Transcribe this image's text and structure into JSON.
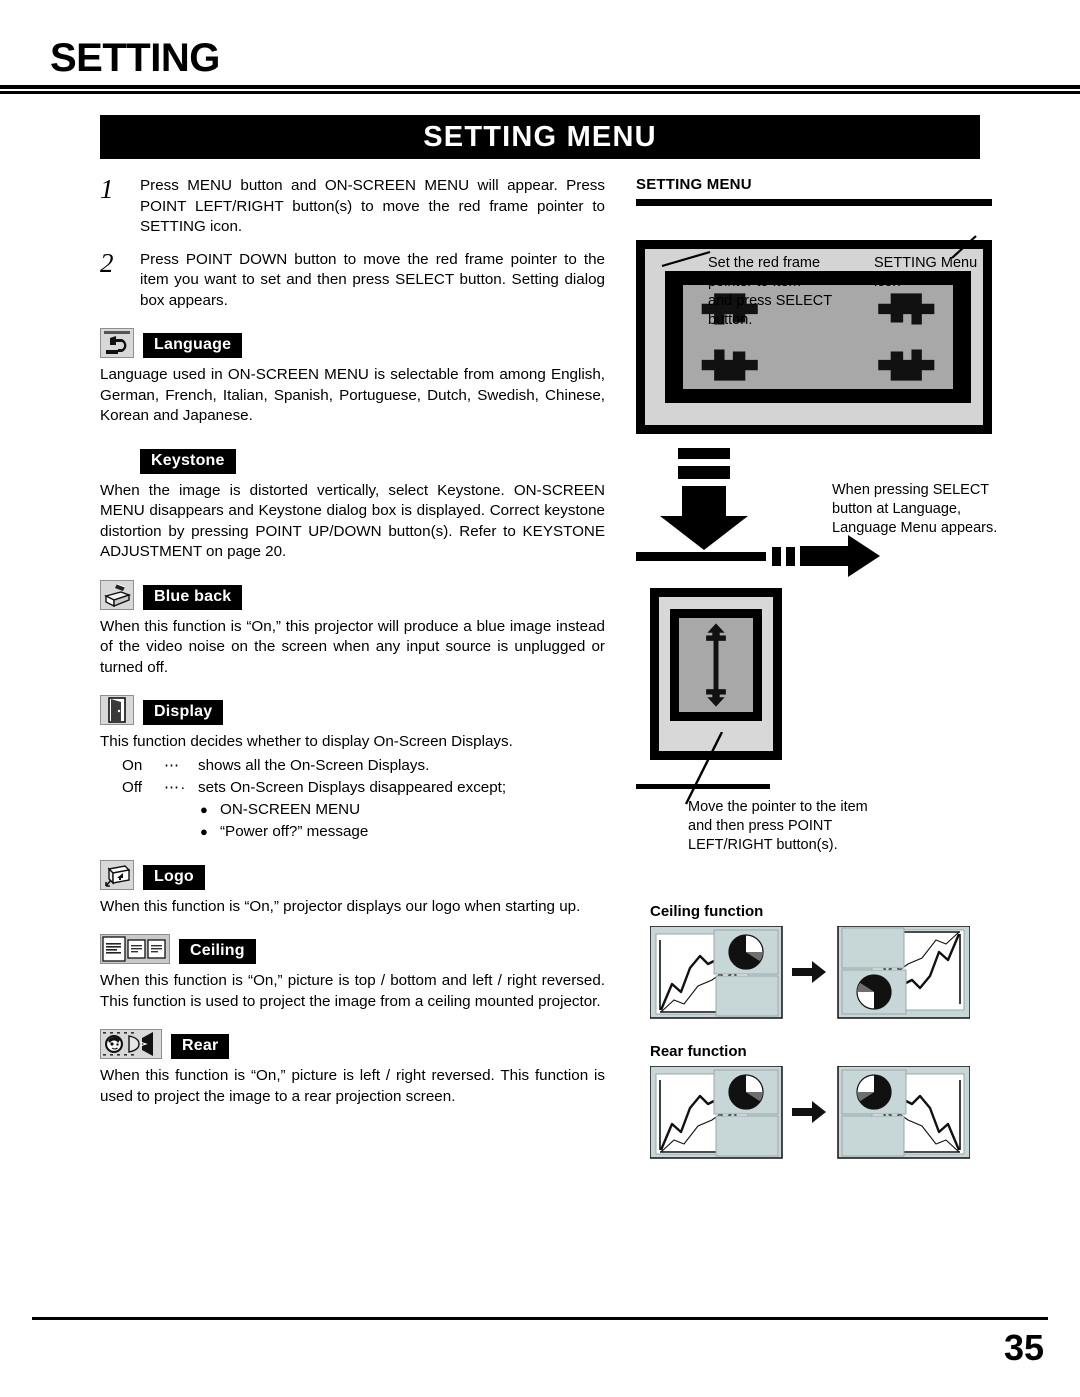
{
  "page": {
    "title": "SETTING",
    "banner": "SETTING MENU",
    "number": "35"
  },
  "steps": [
    {
      "num": "1",
      "text": "Press MENU button and ON-SCREEN MENU will appear.  Press POINT LEFT/RIGHT button(s) to move the red frame pointer to SETTING icon."
    },
    {
      "num": "2",
      "text": "Press POINT DOWN button to move the red frame pointer to the item you want to set and then press SELECT button.  Setting dialog box appears."
    }
  ],
  "sections": [
    {
      "id": "language",
      "label": "Language",
      "icon": "language-return-arrow-icon",
      "body": "Language used in ON-SCREEN MENU is selectable from among English, German, French, Italian, Spanish, Portuguese, Dutch, Swedish, Chinese, Korean and Japanese."
    },
    {
      "id": "keystone",
      "label": "Keystone",
      "icon": "none",
      "body": "When the image is distorted vertically, select Keystone.  ON-SCREEN MENU disappears and Keystone dialog box is displayed. Correct keystone distortion by pressing POINT UP/DOWN button(s). Refer to KEYSTONE ADJUSTMENT on page 20."
    },
    {
      "id": "blue-back",
      "label": "Blue back",
      "icon": "blue-back-projector-icon",
      "body": "When this function is “On,” this projector will produce a blue image instead of the video noise on the screen when any input source is unplugged or turned off."
    },
    {
      "id": "display",
      "label": "Display",
      "icon": "display-door-icon",
      "body": "This function decides whether to display On-Screen Displays."
    },
    {
      "id": "logo",
      "label": "Logo",
      "icon": "logo-box-icon",
      "body": "When this function is “On,” projector displays our logo when starting up."
    },
    {
      "id": "ceiling",
      "label": "Ceiling",
      "icon": "ceiling-panels-icon",
      "body": "When this function is “On,” picture is top / bottom and left / right reversed.  This function is used to project the image from a ceiling mounted projector."
    },
    {
      "id": "rear",
      "label": "Rear",
      "icon": "rear-face-screen-icon",
      "body": "When this function is “On,” picture is left / right reversed.  This function is used to project the image to a rear projection screen."
    }
  ],
  "display_options": [
    {
      "key": "On",
      "dots": "⋯",
      "text": "shows all the On-Screen Displays."
    },
    {
      "key": "Off",
      "dots": "⋯·",
      "text": "sets On-Screen Displays disappeared except;"
    }
  ],
  "display_bullets": [
    "ON-SCREEN MENU",
    "“Power off?” message"
  ],
  "right": {
    "heading": "SETTING MENU",
    "callout_left": "Set the red frame\npointer to Item\nand press SELECT\nbutton.",
    "callout_right": "SETTING Menu icon",
    "note_select": "When pressing SELECT\nbutton at Language,\nLanguage Menu appears.",
    "note_move": "Move the pointer to the item\nand then press POINT\nLEFT/RIGHT button(s).",
    "fig_ceiling_title": "Ceiling function",
    "fig_rear_title": "Rear function"
  },
  "colors": {
    "ink": "#000000",
    "chip_face": "#d8d8d8",
    "shot_light": "#d4d4d4",
    "shot_gray": "#a8a8a8",
    "figure_tint": "#c7d6d6"
  }
}
